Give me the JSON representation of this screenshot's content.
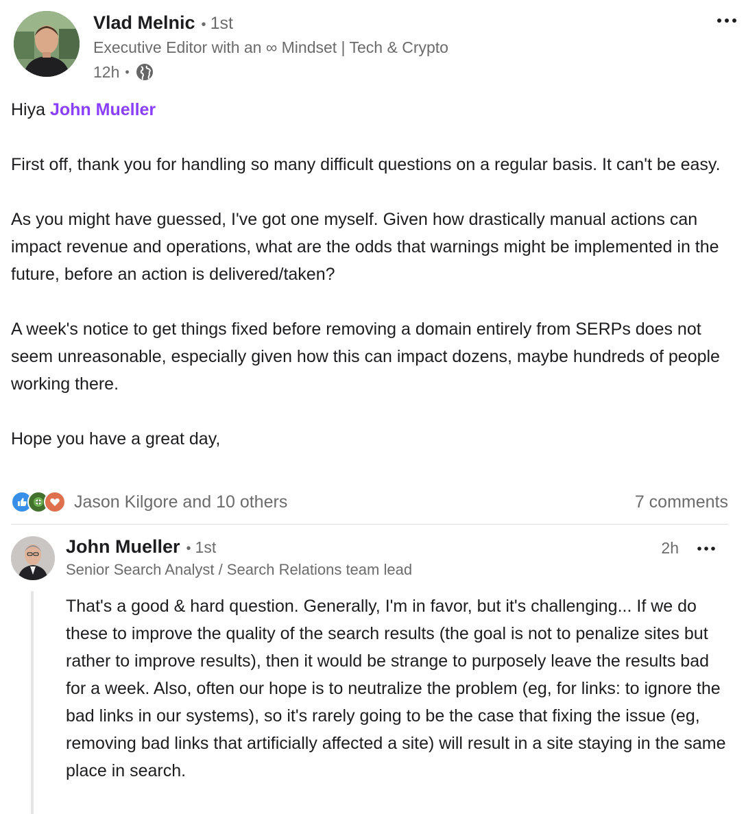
{
  "post": {
    "author": {
      "name": "Vlad Melnic",
      "connection_separator": "•",
      "connection": "1st",
      "headline": "Executive Editor with an ∞ Mindset | Tech & Crypto",
      "time": "12h",
      "time_separator": "•",
      "visibility_icon": "globe-icon"
    },
    "more_menu_icon": "ellipsis-icon",
    "greeting_prefix": "Hiya ",
    "mention": "John Mueller",
    "paragraphs": [
      "First off, thank you for handling so many difficult questions on a regular basis. It can't be easy.",
      "As you might have guessed, I've got one myself. Given how drastically manual actions can impact revenue and operations, what are the odds that warnings might be implemented in the future, before an action is delivered/taken?",
      "A week's notice to get things fixed before removing a domain entirely from SERPs does not seem unreasonable, especially given how this can impact dozens, maybe hundreds of people working there.",
      "Hope you have a great day,"
    ]
  },
  "social": {
    "reaction_icons": [
      "like-icon",
      "celebrate-icon",
      "love-icon"
    ],
    "reactions_text": "Jason Kilgore and 10 others",
    "comments_text": "7 comments"
  },
  "comment": {
    "author": {
      "name": "John Mueller",
      "connection_separator": "•",
      "connection": "1st",
      "headline": "Senior Search Analyst / Search Relations team lead"
    },
    "time": "2h",
    "more_menu_icon": "ellipsis-icon",
    "text": "That's a good & hard question. Generally, I'm in favor, but it's challenging... If we do these to improve the quality of the search results (the goal is not to penalize sites but rather to improve results), then it would be strange to purposely leave the results bad for a week. Also, often our hope is to neutralize the problem (eg, for links: to ignore the bad links in our systems), so it's rarely going to be the case that fixing the issue (eg, removing bad links that artificially affected a site) will result in a site staying in the same place in search."
  },
  "colors": {
    "mention": "#8a3ffc",
    "secondary_text": "#6b6b6b",
    "primary_text": "#1d1d1f",
    "divider": "#dedede"
  }
}
